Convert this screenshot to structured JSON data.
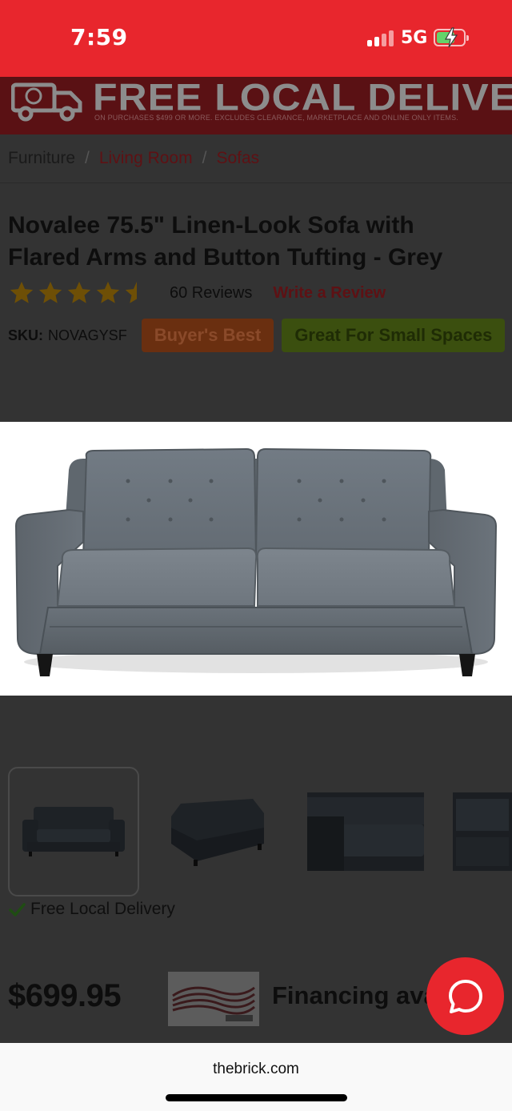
{
  "status_bar": {
    "time": "7:59",
    "network": "5G",
    "battery_color": "#64d36a",
    "background": "#e8262d"
  },
  "banner": {
    "title": "FREE LOCAL DELIVERY",
    "fine_print": "ON PURCHASES $499 OR MORE. EXCLUDES CLEARANCE, MARKETPLACE AND ONLINE ONLY ITEMS.",
    "icon": "delivery-truck-icon"
  },
  "breadcrumb": {
    "items": [
      "Furniture",
      "Living Room",
      "Sofas"
    ],
    "separator": "/"
  },
  "product": {
    "title": "Novalee 75.5\" Linen-Look Sofa with Flared Arms and Button Tufting - Grey",
    "rating_stars": 4.5,
    "reviews": "60 Reviews",
    "write_review": "Write a Review",
    "sku_label": "SKU:",
    "sku_value": "NOVAGYSF",
    "badges": [
      "Buyer's Best",
      "Great For Small Spaces"
    ],
    "free_delivery": "Free Local Delivery",
    "price": "$699.95",
    "financing": "Financing ava"
  },
  "gallery": {
    "main_image": "grey-sofa-photo",
    "thumbnail_count": 4,
    "selected_thumbnail": 1
  },
  "browser": {
    "url": "thebrick.com"
  }
}
